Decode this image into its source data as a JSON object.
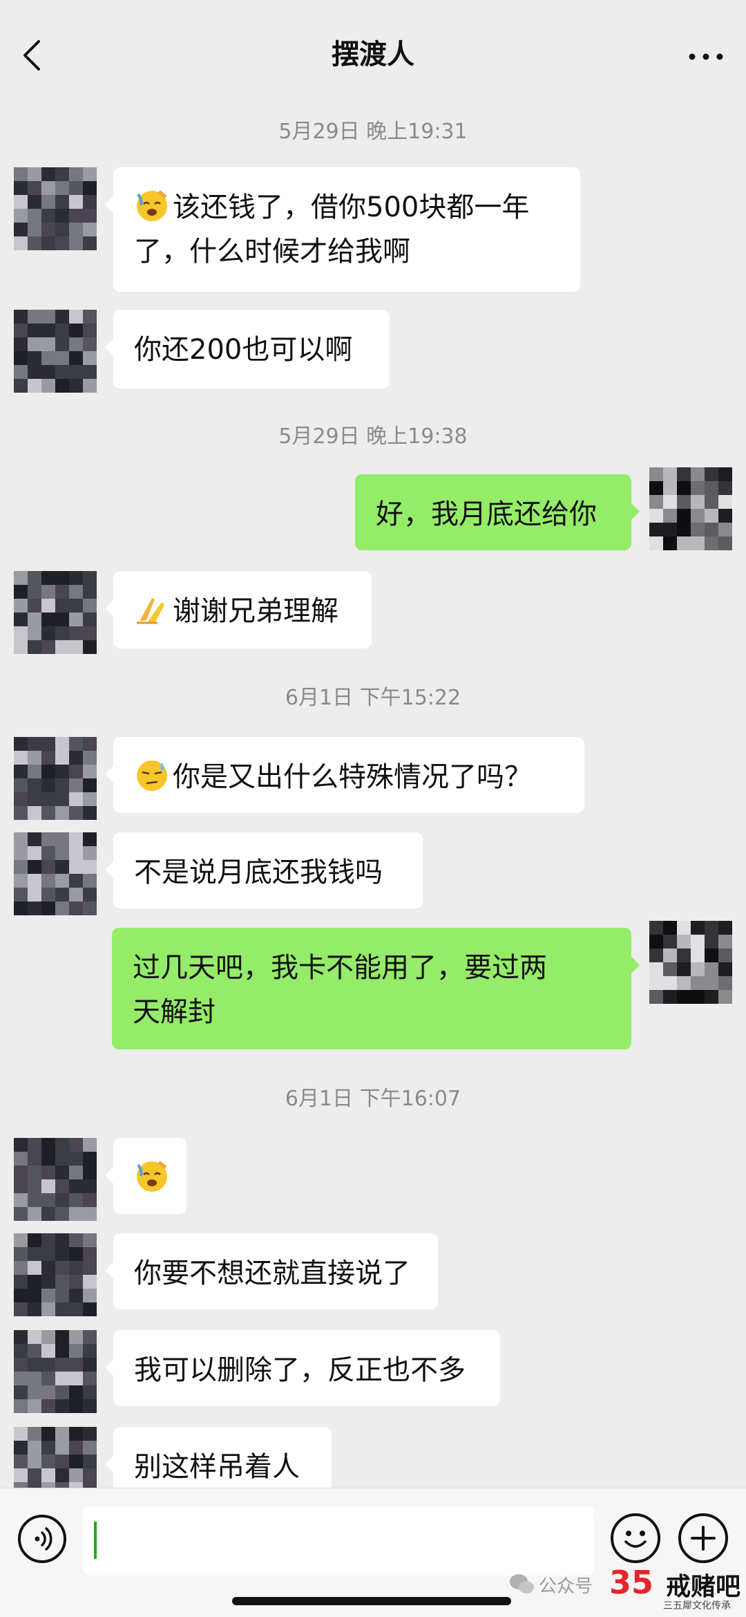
{
  "header": {
    "title": "摆渡人",
    "back_icon": "chevron-left-icon",
    "more_icon": "more-dots-icon"
  },
  "messages": [
    {
      "type": "timestamp",
      "text": "5月29日 晚上19:31"
    },
    {
      "type": "msg",
      "side": "left",
      "emoji": "tired-face",
      "text": "该还钱了，借你500块都一年\n了，什么时候才给我啊"
    },
    {
      "type": "msg",
      "side": "left",
      "text": "你还200也可以啊"
    },
    {
      "type": "timestamp",
      "text": "5月29日 晚上19:38"
    },
    {
      "type": "msg",
      "side": "right",
      "text": "好，我月底还给你"
    },
    {
      "type": "msg",
      "side": "left",
      "emoji": "pray-hands",
      "text": "谢谢兄弟理解"
    },
    {
      "type": "timestamp",
      "text": "6月1日 下午15:22"
    },
    {
      "type": "msg",
      "side": "left",
      "emoji": "sweat-face",
      "text": "你是又出什么特殊情况了吗？"
    },
    {
      "type": "msg",
      "side": "left",
      "text": "不是说月底还我钱吗"
    },
    {
      "type": "msg",
      "side": "right",
      "text": "过几天吧，我卡不能用了，要过两\n天解封"
    },
    {
      "type": "timestamp",
      "text": "6月1日 下午16:07"
    },
    {
      "type": "msg",
      "side": "left",
      "emoji": "tired-face",
      "text": ""
    },
    {
      "type": "msg",
      "side": "left",
      "text": "你要不想还就直接说了"
    },
    {
      "type": "msg",
      "side": "left",
      "text": "我可以删除了，反正也不多"
    },
    {
      "type": "msg",
      "side": "left",
      "text": "别这样吊着人"
    }
  ],
  "input_bar": {
    "voice_icon": "voice-icon",
    "emoji_icon": "smiley-icon",
    "plus_icon": "plus-icon"
  },
  "watermark": {
    "prefix": "公众号",
    "logo": "35",
    "name": "戒赌吧",
    "sub": "三五犀文化传承"
  },
  "colors": {
    "background": "#ededed",
    "bubble_self": "#95ec69",
    "bubble_other": "#ffffff",
    "timestamp": "#8a8a8a"
  }
}
